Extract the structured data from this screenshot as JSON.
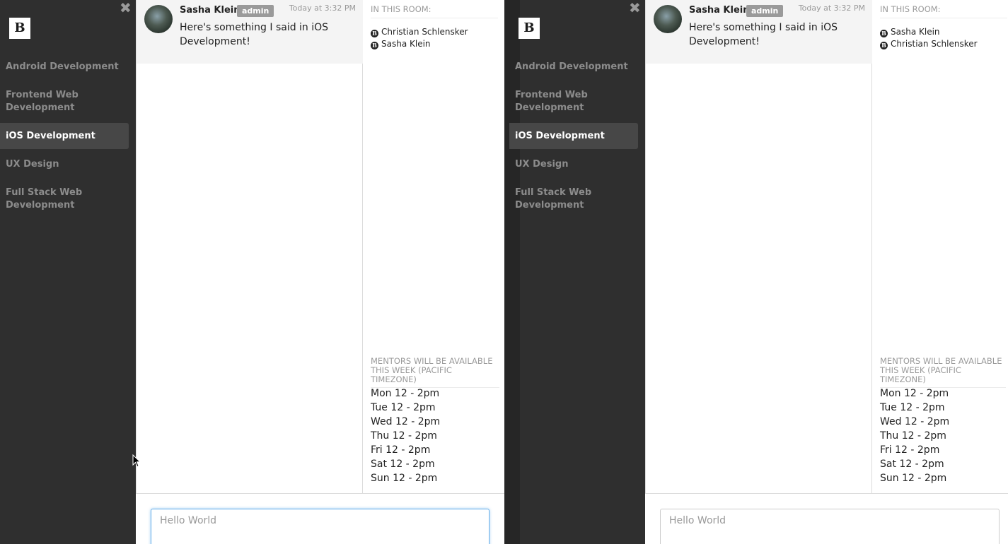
{
  "left_window": {
    "close_label": "✖",
    "logo_letter": "B",
    "rooms": [
      {
        "label": "Android Development"
      },
      {
        "label": "Frontend Web Development"
      },
      {
        "label": "iOS Development"
      },
      {
        "label": "UX Design"
      },
      {
        "label": "Full Stack Web Development"
      }
    ],
    "message": {
      "author": "Sasha Klein",
      "badge": "admin",
      "time": "Today at 3:32 PM",
      "text": "Here's something I said in iOS Development!"
    },
    "room_info": {
      "members_header": "IN THIS ROOM:",
      "members": [
        "Christian Schlensker",
        "Sasha Klein"
      ],
      "mentors_header": "MENTORS WILL BE AVAILABLE THIS WEEK (PACIFIC TIMEZONE)",
      "schedule": [
        "Mon 12 - 2pm",
        "Tue 12 - 2pm",
        "Wed 12 - 2pm",
        "Thu 12 - 2pm",
        "Fri 12 - 2pm",
        "Sat 12 - 2pm",
        "Sun 12 - 2pm"
      ]
    },
    "composer": {
      "placeholder": "Hello World"
    }
  },
  "right_window": {
    "close_label": "✖",
    "logo_letter": "B",
    "rooms": [
      {
        "label": "Android Development"
      },
      {
        "label": "Frontend Web Development"
      },
      {
        "label": "iOS Development"
      },
      {
        "label": "UX Design"
      },
      {
        "label": "Full Stack Web Development"
      }
    ],
    "message": {
      "author": "Sasha Klein",
      "badge": "admin",
      "time": "Today at 3:32 PM",
      "text": "Here's something I said in iOS Development!"
    },
    "room_info": {
      "members_header": "IN THIS ROOM:",
      "members": [
        "Sasha Klein",
        "Christian Schlensker"
      ],
      "mentors_header": "MENTORS WILL BE AVAILABLE THIS WEEK (PACIFIC TIMEZONE)",
      "schedule": [
        "Mon 12 - 2pm",
        "Tue 12 - 2pm",
        "Wed 12 - 2pm",
        "Thu 12 - 2pm",
        "Fri 12 - 2pm",
        "Sat 12 - 2pm",
        "Sun 12 - 2pm"
      ]
    },
    "composer": {
      "placeholder": "Hello World"
    }
  },
  "member_icon_letter": "B"
}
